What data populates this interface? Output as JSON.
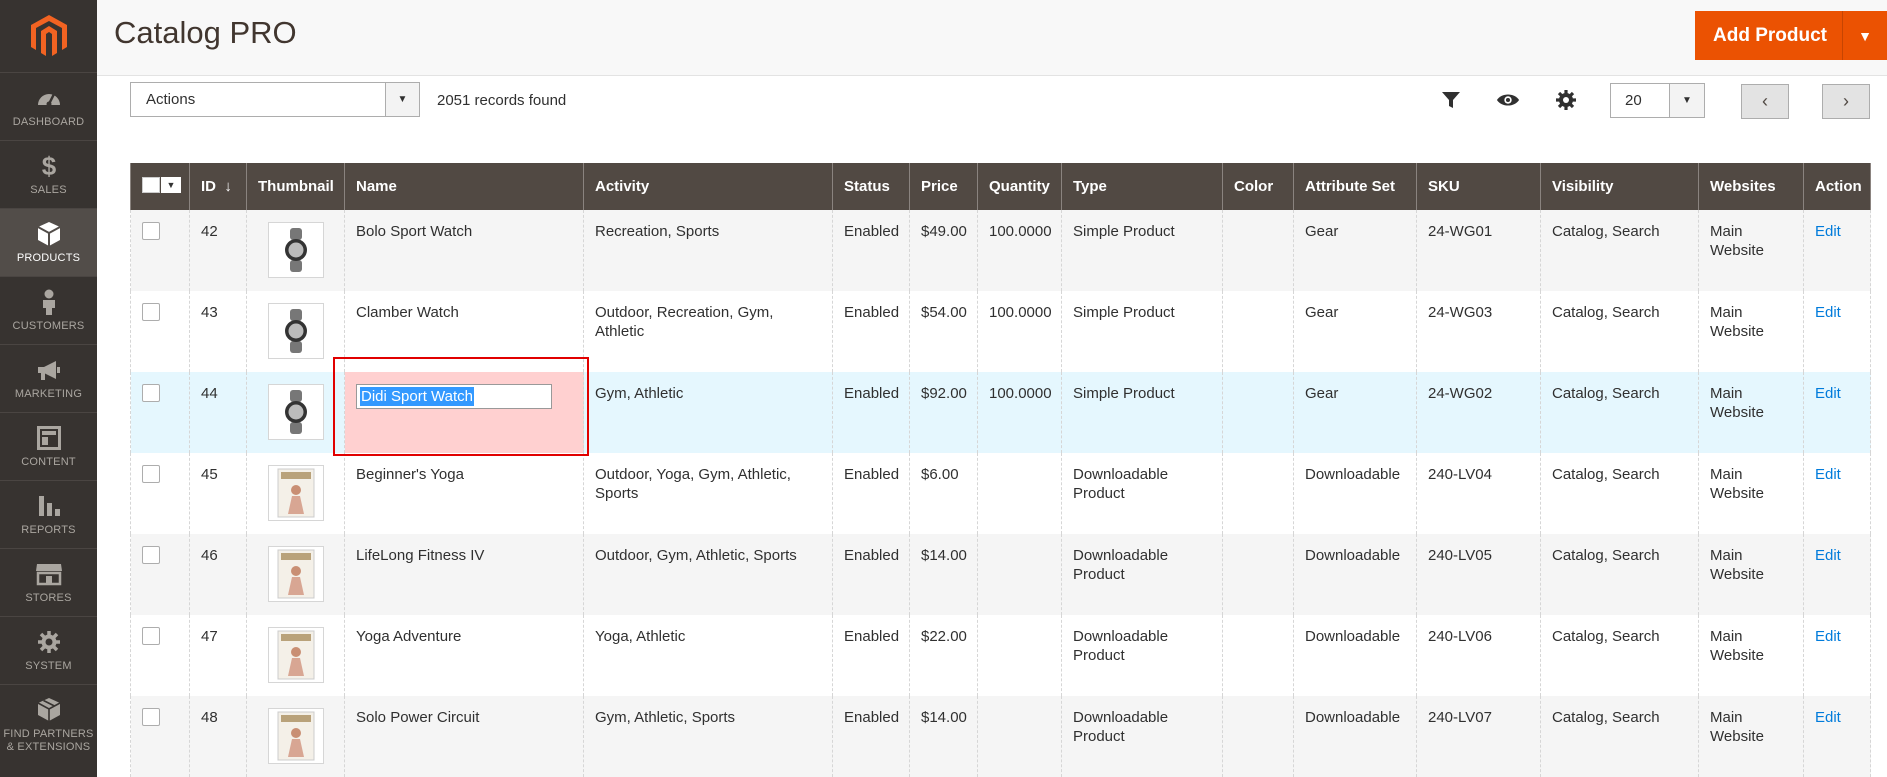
{
  "sidebar": {
    "items": [
      {
        "label": "DASHBOARD",
        "icon": "dashboard-icon"
      },
      {
        "label": "SALES",
        "icon": "dollar-icon"
      },
      {
        "label": "PRODUCTS",
        "icon": "cube-icon"
      },
      {
        "label": "CUSTOMERS",
        "icon": "person-icon"
      },
      {
        "label": "MARKETING",
        "icon": "megaphone-icon"
      },
      {
        "label": "CONTENT",
        "icon": "layout-icon"
      },
      {
        "label": "REPORTS",
        "icon": "bar-chart-icon"
      },
      {
        "label": "STORES",
        "icon": "store-icon"
      },
      {
        "label": "SYSTEM",
        "icon": "gear-icon"
      },
      {
        "label": "FIND PARTNERS & EXTENSIONS",
        "icon": "boxes-icon"
      }
    ],
    "active": "PRODUCTS"
  },
  "header": {
    "title": "Catalog PRO",
    "add_button": "Add Product"
  },
  "toolbar": {
    "actions_label": "Actions",
    "records_found": "2051 records found",
    "per_page": "20"
  },
  "colors": {
    "accent": "#eb5202",
    "header_bg": "#514943",
    "sidebar_bg": "#373330",
    "link": "#007bdb",
    "highlight": "#e10000"
  },
  "grid": {
    "columns": [
      "ID",
      "Thumbnail",
      "Name",
      "Activity",
      "Status",
      "Price",
      "Quantity",
      "Type",
      "Color",
      "Attribute Set",
      "SKU",
      "Visibility",
      "Websites",
      "Action"
    ],
    "sort_indicator": "↓",
    "edit_value": "Didi Sport Watch",
    "rows": [
      {
        "id": "42",
        "name": "Bolo Sport Watch",
        "activity": "Recreation, Sports",
        "status": "Enabled",
        "price": "$49.00",
        "quantity": "100.0000",
        "type": "Simple Product",
        "color": "",
        "attribute_set": "Gear",
        "sku": "24-WG01",
        "visibility": "Catalog, Search",
        "websites": "Main Website",
        "action": "Edit"
      },
      {
        "id": "43",
        "name": "Clamber Watch",
        "activity": "Outdoor, Recreation, Gym, Athletic",
        "status": "Enabled",
        "price": "$54.00",
        "quantity": "100.0000",
        "type": "Simple Product",
        "color": "",
        "attribute_set": "Gear",
        "sku": "24-WG03",
        "visibility": "Catalog, Search",
        "websites": "Main Website",
        "action": "Edit"
      },
      {
        "id": "44",
        "name": "",
        "activity": "Gym, Athletic",
        "status": "Enabled",
        "price": "$92.00",
        "quantity": "100.0000",
        "type": "Simple Product",
        "color": "",
        "attribute_set": "Gear",
        "sku": "24-WG02",
        "visibility": "Catalog, Search",
        "websites": "Main Website",
        "action": "Edit"
      },
      {
        "id": "45",
        "name": "Beginner's Yoga",
        "activity": "Outdoor, Yoga, Gym, Athletic, Sports",
        "status": "Enabled",
        "price": "$6.00",
        "quantity": "",
        "type": "Downloadable Product",
        "color": "",
        "attribute_set": "Downloadable",
        "sku": "240-LV04",
        "visibility": "Catalog, Search",
        "websites": "Main Website",
        "action": "Edit"
      },
      {
        "id": "46",
        "name": "LifeLong Fitness IV",
        "activity": "Outdoor, Gym, Athletic, Sports",
        "status": "Enabled",
        "price": "$14.00",
        "quantity": "",
        "type": "Downloadable Product",
        "color": "",
        "attribute_set": "Downloadable",
        "sku": "240-LV05",
        "visibility": "Catalog, Search",
        "websites": "Main Website",
        "action": "Edit"
      },
      {
        "id": "47",
        "name": "Yoga Adventure",
        "activity": "Yoga, Athletic",
        "status": "Enabled",
        "price": "$22.00",
        "quantity": "",
        "type": "Downloadable Product",
        "color": "",
        "attribute_set": "Downloadable",
        "sku": "240-LV06",
        "visibility": "Catalog, Search",
        "websites": "Main Website",
        "action": "Edit"
      },
      {
        "id": "48",
        "name": "Solo Power Circuit",
        "activity": "Gym, Athletic, Sports",
        "status": "Enabled",
        "price": "$14.00",
        "quantity": "",
        "type": "Downloadable Product",
        "color": "",
        "attribute_set": "Downloadable",
        "sku": "240-LV07",
        "visibility": "Catalog, Search",
        "websites": "Main Website",
        "action": "Edit"
      }
    ]
  }
}
